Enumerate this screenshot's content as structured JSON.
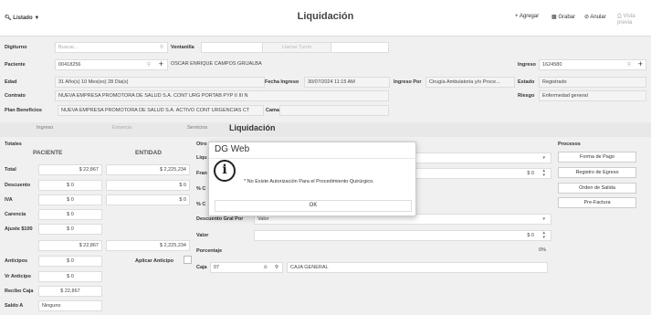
{
  "header": {
    "listado": "Listado",
    "title": "Liquidación",
    "agregar": "Agregar",
    "grabar": "Grabar",
    "anular": "Anular",
    "vista_previa": "Vista previa"
  },
  "form": {
    "digiturno_label": "Digiturno",
    "digiturno_placeholder": "Buscar...",
    "ventanilla_label": "Ventanilla",
    "llamar_turno": "Llamar Turno",
    "paciente_label": "Paciente",
    "paciente_id": "00418256",
    "paciente_name": "OSCAR ENRIQUE CAMPOS GRIJALBA",
    "ingreso_label": "Ingreso",
    "ingreso_value": "1624580",
    "edad_label": "Edad",
    "edad_value": "31 Año(s) 10 Mes(es) 28 Dia(s)",
    "fecha_ingreso_label": "Fecha Ingreso",
    "fecha_ingreso_value": "30/07/2024 11:15 AM",
    "ingreso_por_label": "Ingreso Por",
    "ingreso_por_value": "Cirugía Ambulatoria y/o Proce...",
    "estado_label": "Estado",
    "estado_value": "Registrado",
    "contrato_label": "Contrato",
    "contrato_value": "NUEVA EMPRESA PROMOTORA DE SALUD S.A. CONT URG PORTAB PYP II III N",
    "riesgo_label": "Riesgo",
    "riesgo_value": "Enfermedad general",
    "plan_label": "Plan Beneficios",
    "plan_value": "NUEVA EMPRESA PROMOTORA DE SALUD S.A. ACTIVO CONT URGENCIAS CT",
    "cama_label": "Cama"
  },
  "tabs": {
    "ingreso": "Ingreso",
    "estancia": "Estancia",
    "servicios": "Servicios",
    "liquidacion": "Liquidación"
  },
  "totales": {
    "header": "Totales",
    "paciente_col": "PACIENTE",
    "entidad_col": "ENTIDAD",
    "rows": {
      "total_label": "Total",
      "total_pac": "$ 22,867",
      "total_ent": "$ 2,225,234",
      "descuento_label": "Descuento",
      "descuento_pac": "$ 0",
      "descuento_ent": "$ 0",
      "iva_label": "IVA",
      "iva_pac": "$ 0",
      "iva_ent": "$ 0",
      "carencia_label": "Carencia",
      "carencia_pac": "$ 0",
      "ajuste_label": "Ajuste $100",
      "ajuste_pac": "$ 0",
      "subtotal_pac": "$ 22,867",
      "subtotal_ent": "$ 2,225,234",
      "anticipos_label": "Anticipos",
      "anticipos_pac": "$ 0",
      "aplicar_anticipo_label": "Aplicar Anticipo",
      "vr_anticipo_label": "Vr Anticipo",
      "vr_anticipo_pac": "$ 0",
      "recibo_caja_label": "Recibo Caja",
      "recibo_caja_pac": "$ 22,867",
      "saldo_label": "Saldo A",
      "saldo_value": "Ninguno"
    }
  },
  "middle": {
    "otro_label": "Otro",
    "liq_label": "Liqu",
    "fran_label": "Fran",
    "pc1_label": "% C",
    "pc2_label": "% C",
    "fran_value": "$ 0",
    "descuento_gral_label": "Descuento Gral Por",
    "descuento_gral_value": "Valor",
    "valor_label": "Valor",
    "valor_value": "$ 0",
    "porcentaje_label": "Porcentaje",
    "porcentaje_value": "0%",
    "caja_label": "Caja",
    "caja_code": "07",
    "caja_name": "CAJA GENERAL"
  },
  "procesos": {
    "header": "Procesos",
    "forma_pago": "Forma de Pago",
    "registro_egreso": "Registro de Egreso",
    "orden_salida": "Orden de Salida",
    "pre_factura": "Pre-Factura"
  },
  "modal": {
    "title": "DG Web",
    "message": "* No Existe Autorización Para el Procedimiento Quirúrgico.",
    "ok": "OK"
  }
}
